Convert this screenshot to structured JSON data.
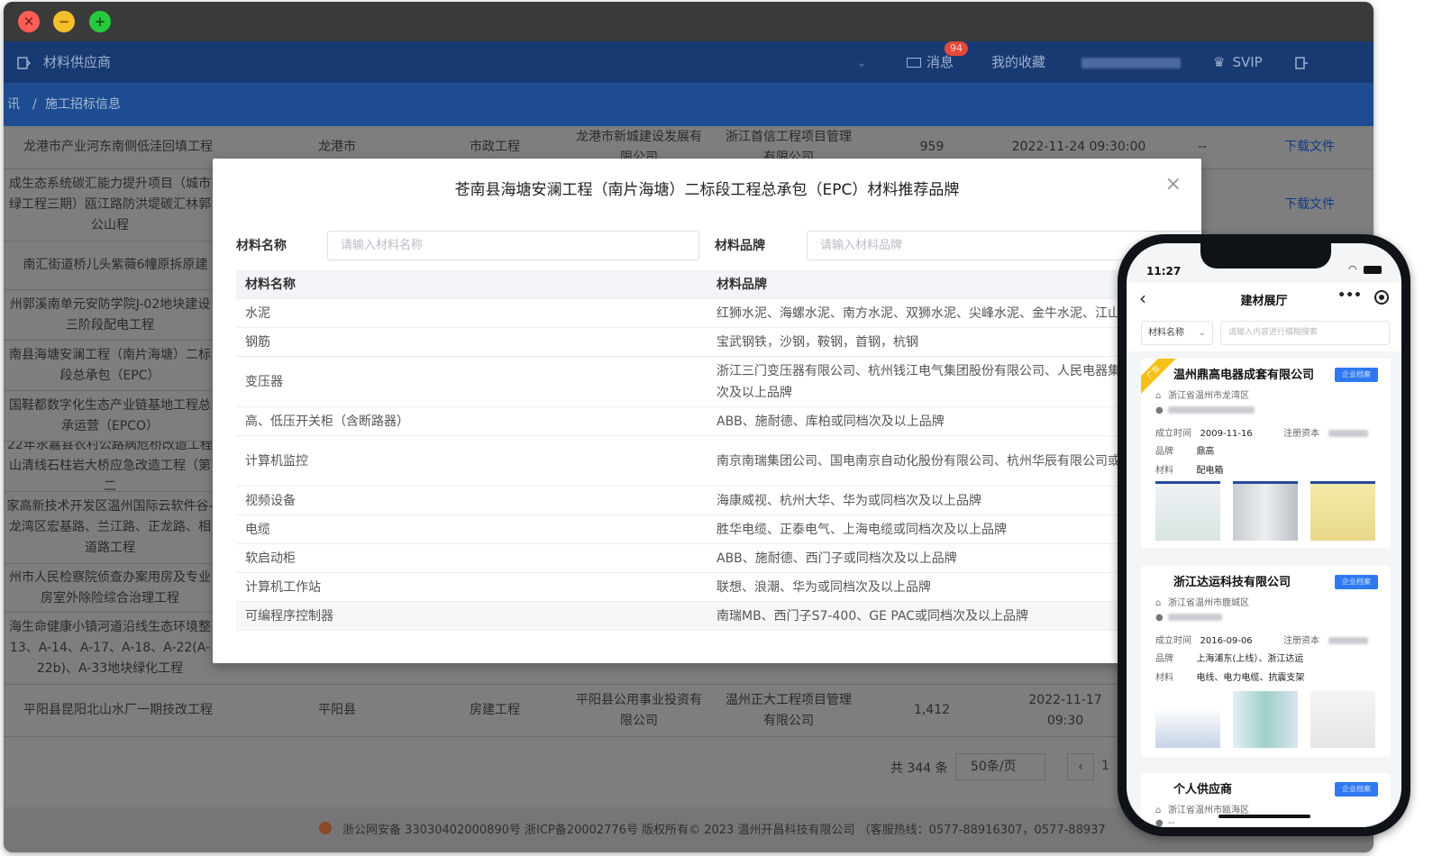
{
  "window": {
    "controls": {
      "close": "✕",
      "minimize": "−",
      "zoom": "+"
    }
  },
  "appbar": {
    "title": "材料供应商",
    "messages_label": "消息",
    "messages_badge": "94",
    "favorites_label": "我的收藏",
    "svip_label": "SVIP"
  },
  "breadcrumb": {
    "parent": "讯",
    "separator": "/",
    "current": "施工招标信息"
  },
  "bg_table": {
    "rows": [
      {
        "name": "龙港市产业河东南侧低洼回填工程",
        "region": "龙港市",
        "type": "市政工程",
        "owner": "龙港市新城建设发展有限公司",
        "agency": "浙江首信工程项目管理有限公司",
        "count": "959",
        "time": "2022-11-24 09:30:00",
        "dash": "--",
        "action": "下载文件"
      },
      {
        "name": "成生态系统碳汇能力提升项目（城市绿工程三期）瓯江路防洪堤碳汇林郭公山程",
        "action": "下载文件"
      },
      {
        "name": "南汇街道桥儿头紫薇6幢原拆原建"
      },
      {
        "name": "州郭溪南单元安防学院J-02地块建设三阶段配电工程"
      },
      {
        "name": "南县海塘安澜工程（南片海塘）二标段总承包（EPC）"
      },
      {
        "name": "国鞋都数字化生态产业链基地工程总承运营（EPCO）"
      },
      {
        "name": "22年永嘉县农村公路病危桥改造工程山清线石柱岩大桥应急改造工程（第二"
      },
      {
        "name": "家高新技术开发区温州国际云软件谷-龙湾区宏基路、兰江路、正龙路、相道路工程"
      },
      {
        "name": "州市人民检察院侦查办案用房及专业房室外除险综合治理工程"
      },
      {
        "name": "海生命健康小镇河道沿线生态环境整13、A-14、A-17、A-18、A-22(A-22b)、A-33地块绿化工程"
      },
      {
        "name": "平阳县昆阳北山水厂一期技改工程",
        "region": "平阳县",
        "type": "房建工程",
        "owner": "平阳县公用事业投资有限公司",
        "agency": "温州正大工程项目管理有限公司",
        "count": "1,412",
        "time": "2022-11-17 09:30"
      }
    ],
    "pager": {
      "total": "共 344 条",
      "page_size": "50条/页",
      "prev": "‹",
      "current": "1"
    },
    "footer": "浙公网安备 33030402000890号   浙ICP备20002776号   版权所有© 2023 温州开昌科技有限公司   （客服热线：0577-88916307，0577-88937"
  },
  "modal": {
    "title": "苍南县海塘安澜工程（南片海塘）二标段工程总承包（EPC）材料推荐品牌",
    "close": "×",
    "filters": {
      "name_label": "材料名称",
      "name_placeholder": "请输入材料名称",
      "brand_label": "材料品牌",
      "brand_placeholder": "请输入材料品牌"
    },
    "columns": [
      "材料名称",
      "材料品牌"
    ],
    "rows": [
      {
        "material": "水泥",
        "brands": "红狮水泥、海螺水泥、南方水泥、双狮水泥、尖峰水泥、金牛水泥、江山"
      },
      {
        "material": "钢筋",
        "brands": "宝武钢铁，沙钢，鞍钢，首钢，杭钢"
      },
      {
        "material": "变压器",
        "brands": "浙江三门变压器有限公司、杭州钱江电气集团股份有限公司、人民电器集器有限公司或同档次及以上品牌"
      },
      {
        "material": "高、低压开关柜（含断路器）",
        "brands": "ABB、施耐德、库柏或同档次及以上品牌"
      },
      {
        "material": "计算机监控",
        "brands": "南京南瑞集团公司、国电南京自动化股份有限公司、杭州华辰有限公司或及以上品牌"
      },
      {
        "material": "视频设备",
        "brands": "海康威视、杭州大华、华为或同档次及以上品牌"
      },
      {
        "material": "电缆",
        "brands": "胜华电缆、正泰电气、上海电缆或同档次及以上品牌"
      },
      {
        "material": "软启动柜",
        "brands": "ABB、施耐德、西门子或同档次及以上品牌"
      },
      {
        "material": "计算机工作站",
        "brands": "联想、浪潮、华为或同档次及以上品牌"
      },
      {
        "material": "可编程序控制器",
        "brands": "南瑞MB、西门子S7-400、GE PAC或同档次及以上品牌"
      }
    ]
  },
  "phone": {
    "time": "11:27",
    "title": "建材展厅",
    "back": "‹",
    "more": "•••",
    "filter_select": "材料名称",
    "filter_placeholder": "请输入内容进行模糊搜索",
    "cards": [
      {
        "name": "温州鼎高电器成套有限公司",
        "ribbon": "广告",
        "badge": "企业档案",
        "address": "浙江省温州市龙湾区",
        "founded_label": "成立时间",
        "founded": "2009-11-16",
        "capital_label": "注册资本",
        "brand_label": "品牌",
        "brand": "鼎高",
        "material_label": "材料",
        "material": "配电箱"
      },
      {
        "name": "浙江达运科技有限公司",
        "badge": "企业档案",
        "address": "浙江省温州市鹿城区",
        "founded_label": "成立时间",
        "founded": "2016-09-06",
        "capital_label": "注册资本",
        "brand_label": "品牌",
        "brand": "上海浦东(上线）、浙江达运",
        "material_label": "材料",
        "material": "电线、电力电缆、抗震支架"
      },
      {
        "name": "个人供应商",
        "badge": "企业档案",
        "address": "浙江省温州市瓯海区",
        "extra": "--"
      }
    ]
  },
  "colors": {
    "appbar": "#173a73",
    "crumbbar": "#1d4c92",
    "overlay": "#7e7e7e",
    "accent_blue": "#2e79f0",
    "badge_red": "#e5483b"
  }
}
